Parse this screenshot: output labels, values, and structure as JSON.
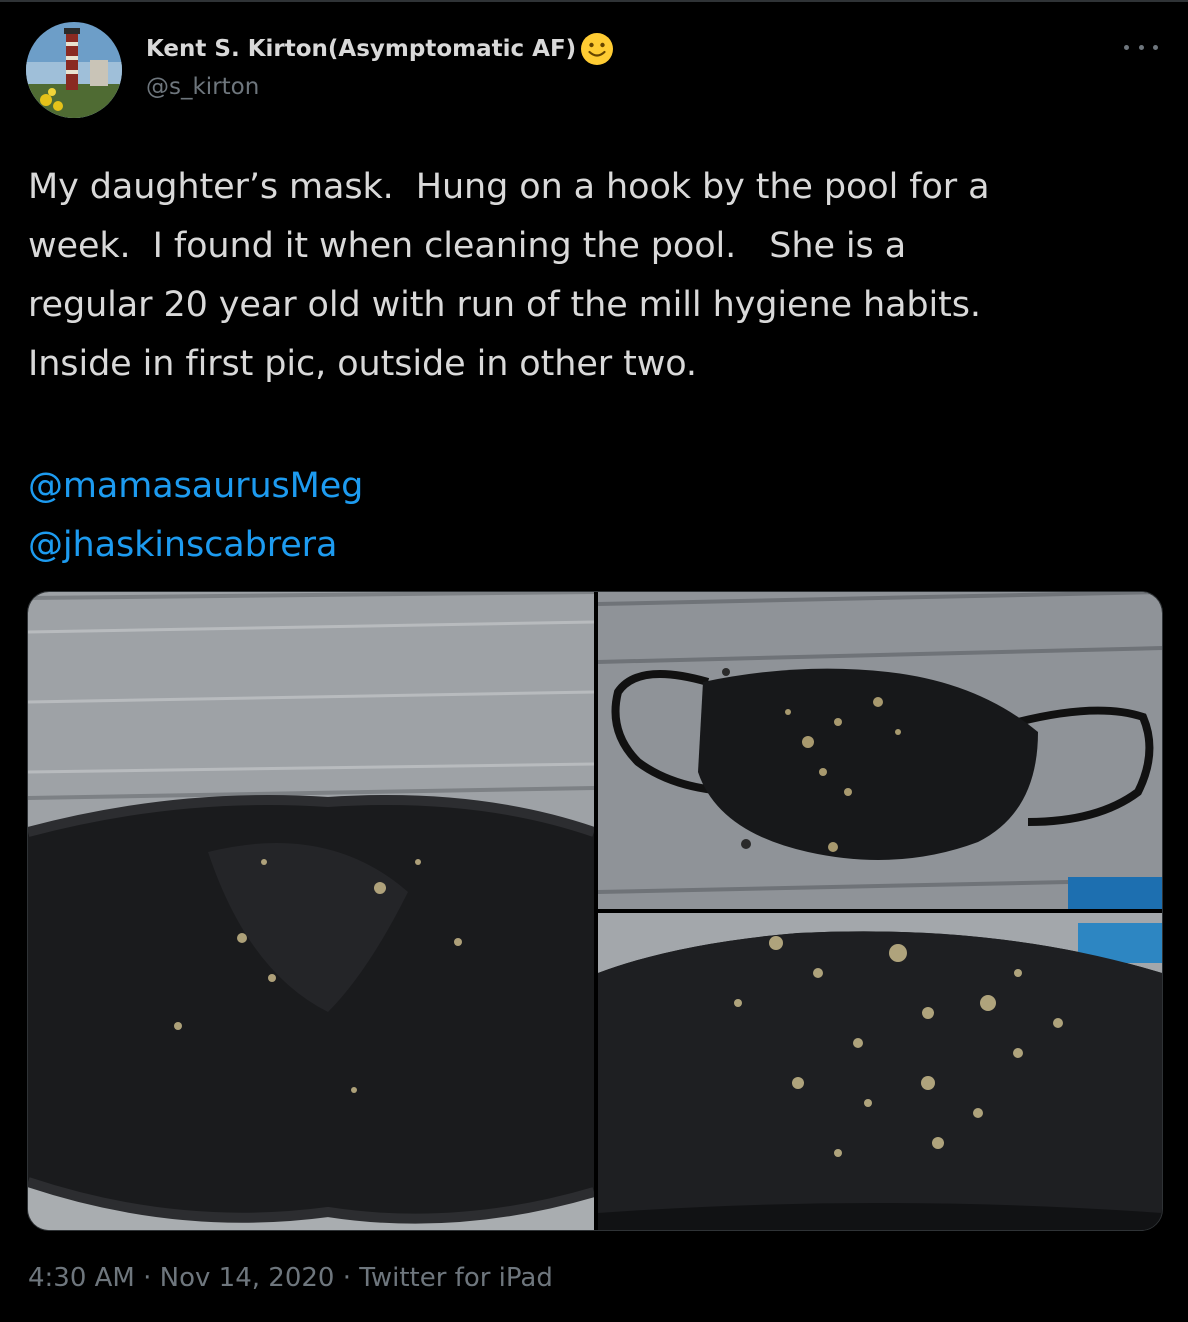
{
  "author": {
    "display_name": "Kent S. Kirton(Asymptomatic AF)",
    "handle": "@s_kirton",
    "avatar_icon": "lighthouse-avatar",
    "name_emoji": "slightly-smiling-face-icon"
  },
  "tweet": {
    "lines": [
      "My daughter’s mask.  Hung on a hook by the pool for a",
      "week.  I found it when cleaning the pool.   She is a",
      "regular 20 year old with run of the mill hygiene habits.",
      "Inside in first pic, outside in other two."
    ],
    "mentions": [
      "@mamasaurusMeg",
      "@jhaskinscabrera"
    ]
  },
  "media": {
    "photos": [
      {
        "name": "mask-inside-photo"
      },
      {
        "name": "mask-outside-photo"
      },
      {
        "name": "mask-outside-closeup-photo"
      }
    ]
  },
  "meta": {
    "time": "4:30 AM",
    "separator": "·",
    "date": "Nov 14, 2020",
    "source": "Twitter for iPad"
  },
  "colors": {
    "background": "#000000",
    "text": "#d9d9d9",
    "secondary": "#6e767d",
    "link": "#1d9bf0"
  }
}
